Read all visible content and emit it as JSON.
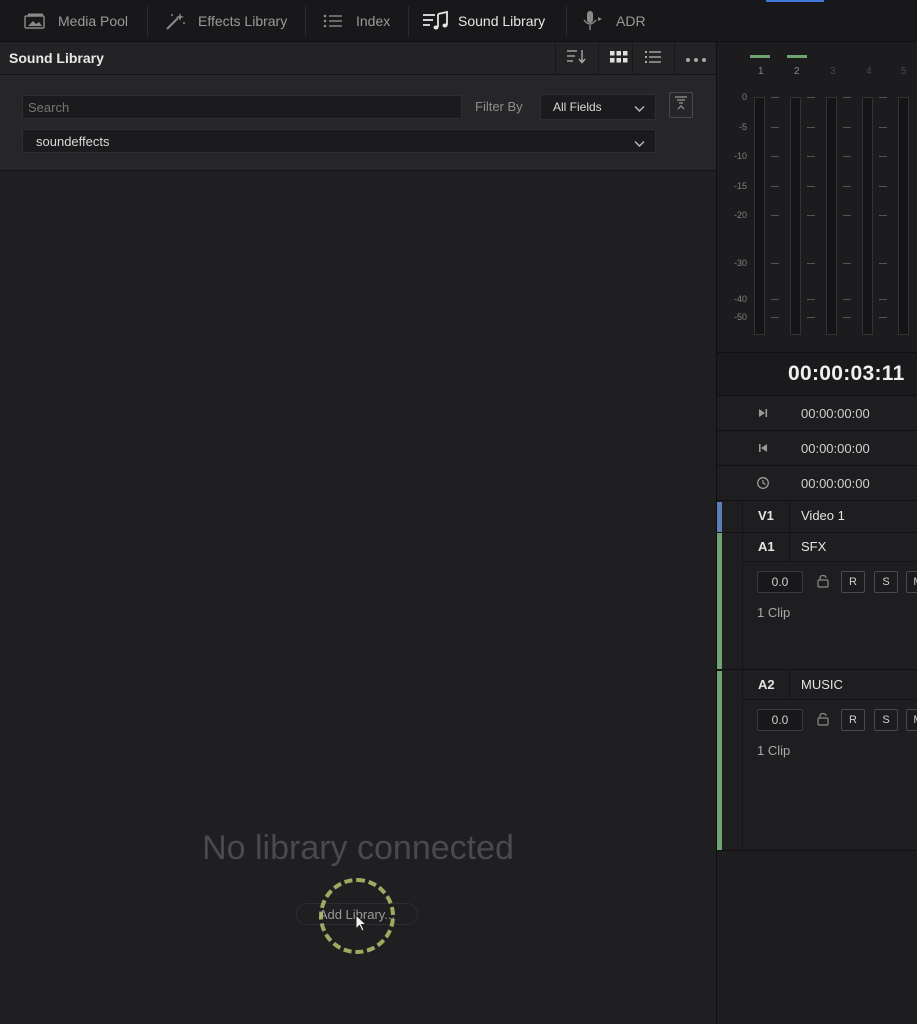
{
  "tabs": [
    {
      "label": "Media Pool",
      "icon": "media-pool-icon"
    },
    {
      "label": "Effects Library",
      "icon": "magic-wand-icon"
    },
    {
      "label": "Index",
      "icon": "list-icon"
    },
    {
      "label": "Sound Library",
      "icon": "music-note-icon",
      "active": true
    },
    {
      "label": "ADR",
      "icon": "microphone-icon"
    }
  ],
  "panel": {
    "title": "Sound Library",
    "search_placeholder": "Search",
    "filter_label": "Filter By",
    "filter_value": "All Fields",
    "library_value": "soundeffects",
    "empty_message": "No library connected",
    "add_library_label": "Add Library..."
  },
  "meters": {
    "channels": [
      "1",
      "2",
      "3",
      "4",
      "5"
    ],
    "scale": [
      "0",
      "-5",
      "-10",
      "-15",
      "-20",
      "-30",
      "-40",
      "-50"
    ]
  },
  "timecode": {
    "main": "00:00:03:11",
    "rows": [
      {
        "icon": "skip-to-end-icon",
        "value": "00:00:00:00"
      },
      {
        "icon": "skip-to-start-icon",
        "value": "00:00:00:00"
      },
      {
        "icon": "clock-icon",
        "value": "00:00:00:00"
      }
    ]
  },
  "tracks": [
    {
      "id": "V1",
      "name": "Video 1",
      "color": "#5d7fb6"
    },
    {
      "id": "A1",
      "name": "SFX",
      "volume": "0.0",
      "buttons": [
        "R",
        "S",
        "M"
      ],
      "clips": "1 Clip",
      "color": "#6fa36f"
    },
    {
      "id": "A2",
      "name": "MUSIC",
      "volume": "0.0",
      "buttons": [
        "R",
        "S",
        "M"
      ],
      "clips": "1 Clip",
      "color": "#6fa36f"
    }
  ],
  "colors": {
    "accent_blue": "#3b78d6",
    "track_green": "#6fa36f",
    "highlight_ring": "#b2c46e"
  }
}
